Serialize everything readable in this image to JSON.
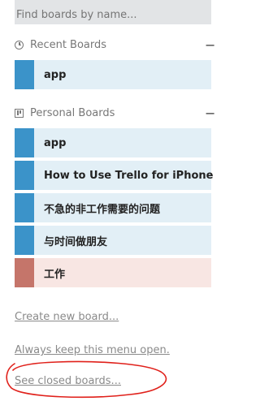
{
  "search": {
    "placeholder": "Find boards by name..."
  },
  "recent": {
    "title": "Recent Boards",
    "collapse": "−",
    "boards": [
      {
        "name": "app",
        "color": "#3b93c9"
      }
    ]
  },
  "personal": {
    "title": "Personal Boards",
    "collapse": "−",
    "boards": [
      {
        "name": "app",
        "color": "#3b93c9"
      },
      {
        "name": "How to Use Trello for iPhone",
        "color": "#3b93c9"
      },
      {
        "name": "不急的非工作需要的问题",
        "color": "#3b93c9"
      },
      {
        "name": "与时间做朋友",
        "color": "#3b93c9"
      },
      {
        "name": "工作",
        "color": "#c5756a"
      }
    ]
  },
  "links": {
    "create": "Create new board...",
    "keep_open": "Always keep this menu open.",
    "closed": "See closed boards..."
  },
  "annotation": {
    "color": "#e0201a"
  }
}
